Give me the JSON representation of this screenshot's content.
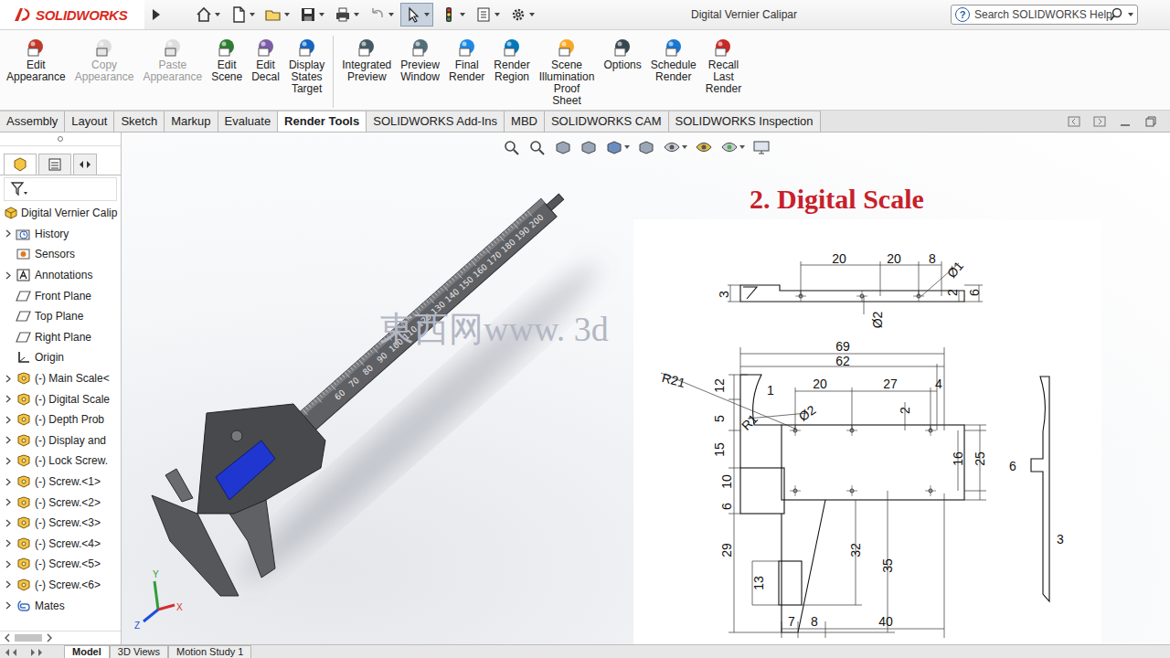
{
  "window": {
    "title": "Digital Vernier Calipar"
  },
  "logo": {
    "text": "SOLIDWORKS"
  },
  "search": {
    "help_icon": "?",
    "placeholder": "Search SOLIDWORKS Help"
  },
  "ribbon": [
    {
      "label": "Edit Appearance",
      "disabled": false
    },
    {
      "label": "Copy Appearance",
      "disabled": true
    },
    {
      "label": "Paste Appearance",
      "disabled": true
    },
    {
      "label": "Edit Scene",
      "disabled": false
    },
    {
      "label": "Edit Decal",
      "disabled": false
    },
    {
      "label": "Display States Target",
      "disabled": false
    },
    {
      "label": "Integrated Preview",
      "disabled": false
    },
    {
      "label": "Preview Window",
      "disabled": false
    },
    {
      "label": "Final Render",
      "disabled": false
    },
    {
      "label": "Render Region",
      "disabled": false
    },
    {
      "label": "Scene Illumination Proof Sheet",
      "disabled": false
    },
    {
      "label": "Options",
      "disabled": false
    },
    {
      "label": "Schedule Render",
      "disabled": false
    },
    {
      "label": "Recall Last Render",
      "disabled": false
    }
  ],
  "tabs": [
    {
      "label": "Assembly",
      "selected": false
    },
    {
      "label": "Layout",
      "selected": false
    },
    {
      "label": "Sketch",
      "selected": false
    },
    {
      "label": "Markup",
      "selected": false
    },
    {
      "label": "Evaluate",
      "selected": false
    },
    {
      "label": "Render Tools",
      "selected": true
    },
    {
      "label": "SOLIDWORKS Add-Ins",
      "selected": false
    },
    {
      "label": "MBD",
      "selected": false
    },
    {
      "label": "SOLIDWORKS CAM",
      "selected": false
    },
    {
      "label": "SOLIDWORKS Inspection",
      "selected": false
    }
  ],
  "tree": {
    "root": "Digital Vernier Calip",
    "items": [
      {
        "label": "History",
        "kind": "history",
        "expandable": true
      },
      {
        "label": "Sensors",
        "kind": "sensors",
        "expandable": false
      },
      {
        "label": "Annotations",
        "kind": "annotations",
        "expandable": true
      },
      {
        "label": "Front Plane",
        "kind": "plane",
        "expandable": false
      },
      {
        "label": "Top Plane",
        "kind": "plane",
        "expandable": false
      },
      {
        "label": "Right Plane",
        "kind": "plane",
        "expandable": false
      },
      {
        "label": "Origin",
        "kind": "origin",
        "expandable": false
      },
      {
        "label": "(-) Main Scale<",
        "kind": "part",
        "expandable": true
      },
      {
        "label": "(-) Digital Scale",
        "kind": "part",
        "expandable": true
      },
      {
        "label": "(-) Depth Prob",
        "kind": "part",
        "expandable": true
      },
      {
        "label": "(-) Display and",
        "kind": "part",
        "expandable": true
      },
      {
        "label": "(-) Lock Screw.",
        "kind": "part",
        "expandable": true
      },
      {
        "label": "(-) Screw.<1>",
        "kind": "part",
        "expandable": true
      },
      {
        "label": "(-) Screw.<2>",
        "kind": "part",
        "expandable": true
      },
      {
        "label": "(-) Screw.<3>",
        "kind": "part",
        "expandable": true
      },
      {
        "label": "(-) Screw.<4>",
        "kind": "part",
        "expandable": true
      },
      {
        "label": "(-) Screw.<5>",
        "kind": "part",
        "expandable": true
      },
      {
        "label": "(-) Screw.<6>",
        "kind": "part",
        "expandable": true
      },
      {
        "label": "Mates",
        "kind": "mates",
        "expandable": true
      }
    ]
  },
  "overlay": {
    "title": "2. Digital Scale",
    "watermark": "東西网www. 3d"
  },
  "drawing": {
    "top_view": [
      "20",
      "20",
      "8",
      "Ø1",
      "3",
      "2",
      "6",
      "Ø2"
    ],
    "front_view": [
      "69",
      "62",
      "R21",
      "12",
      "1",
      "20",
      "27",
      "4",
      "Ø2",
      "2",
      "5",
      "R1",
      "15",
      "16",
      "25",
      "10",
      "6",
      "29",
      "32",
      "35",
      "13",
      "7",
      "8",
      "40"
    ],
    "side_view": [
      "6",
      "3"
    ]
  },
  "model": {
    "scale_numbers": [
      "60",
      "70",
      "80",
      "90",
      "100",
      "110",
      "120",
      "130",
      "140",
      "150",
      "160",
      "170",
      "180",
      "190",
      "200"
    ]
  },
  "triad": {
    "x": "X",
    "y": "Y",
    "z": "Z"
  },
  "bottom_tabs": [
    {
      "label": "Model",
      "selected": true
    },
    {
      "label": "3D Views",
      "selected": false
    },
    {
      "label": "Motion Study 1",
      "selected": false
    }
  ]
}
